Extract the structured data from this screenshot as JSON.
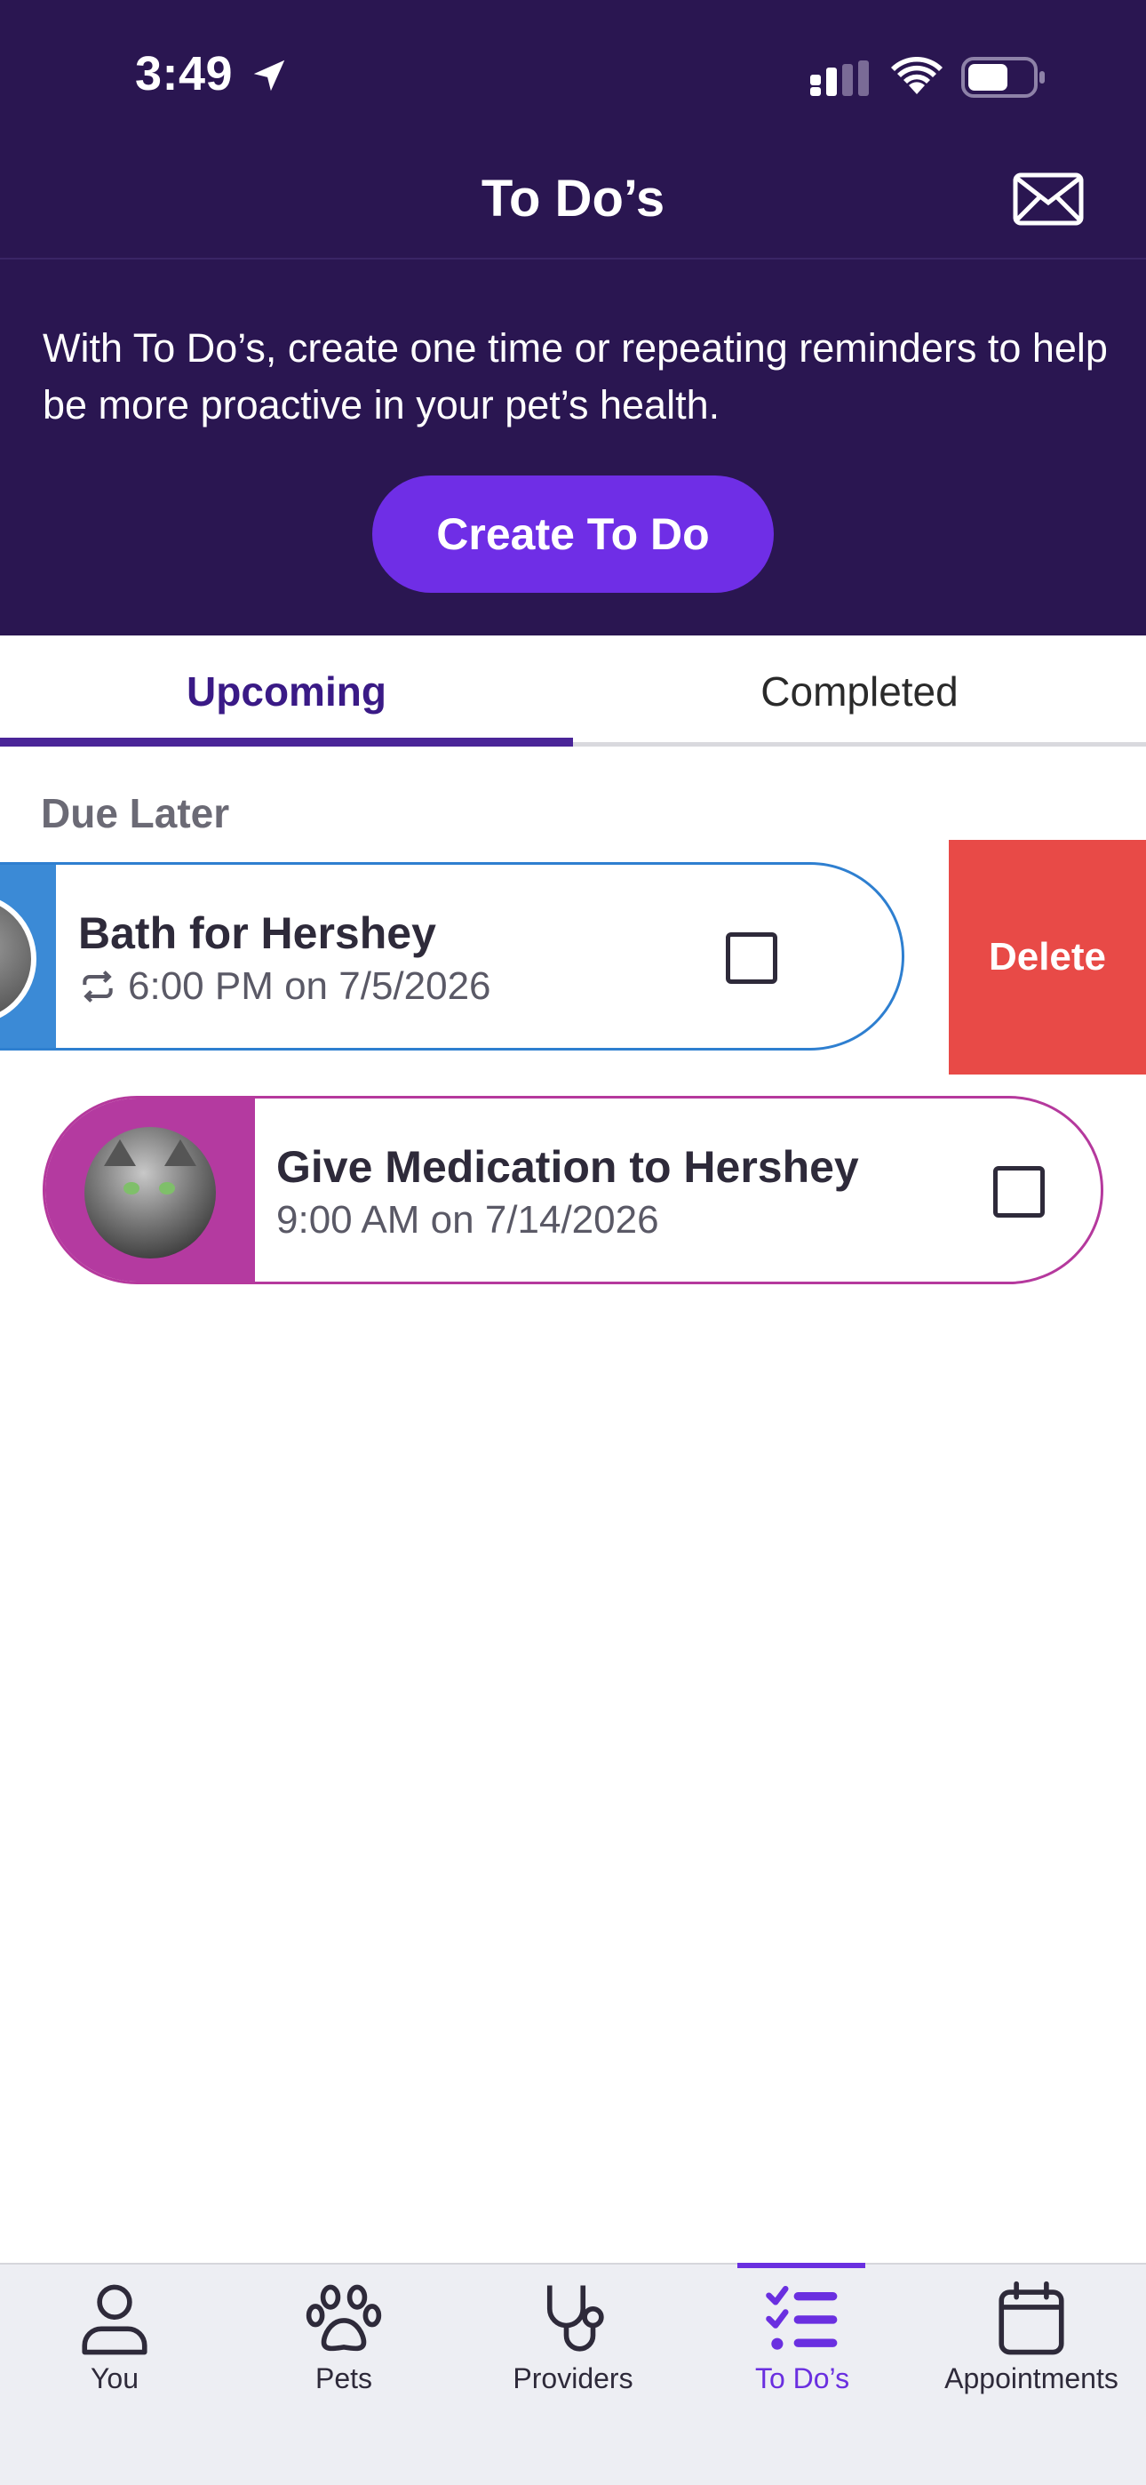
{
  "status_bar": {
    "time": "3:49"
  },
  "header": {
    "title": "To Do’s"
  },
  "intro": {
    "text": "With To Do’s, create one time or repeating reminders to help be more proactive in your pet’s health."
  },
  "create_button": {
    "label": "Create To Do"
  },
  "tabs": [
    {
      "label": "Upcoming",
      "active": true
    },
    {
      "label": "Completed",
      "active": false
    }
  ],
  "section": {
    "label": "Due Later"
  },
  "todos": [
    {
      "title": "Bath for Hershey",
      "schedule": "6:00 PM on 7/5/2026",
      "repeating": true,
      "checked": false,
      "accent_color": "#3b8ad6"
    },
    {
      "title": "Give Medication to Hershey",
      "schedule": "9:00 AM on 7/14/2026",
      "repeating": false,
      "checked": false,
      "accent_color": "#b43aa0"
    }
  ],
  "swipe_action": {
    "label": "Delete",
    "color": "#e84a47"
  },
  "tabbar": {
    "items": [
      {
        "label": "You",
        "icon": "person-icon",
        "active": false
      },
      {
        "label": "Pets",
        "icon": "paw-icon",
        "active": false
      },
      {
        "label": "Providers",
        "icon": "stethoscope-icon",
        "active": false
      },
      {
        "label": "To Do’s",
        "icon": "checklist-icon",
        "active": true
      },
      {
        "label": "Appointments",
        "icon": "calendar-icon",
        "active": false
      }
    ]
  },
  "colors": {
    "header_bg": "#2a1651",
    "accent_purple": "#6f2ee6",
    "active_tab": "#4a2598"
  }
}
